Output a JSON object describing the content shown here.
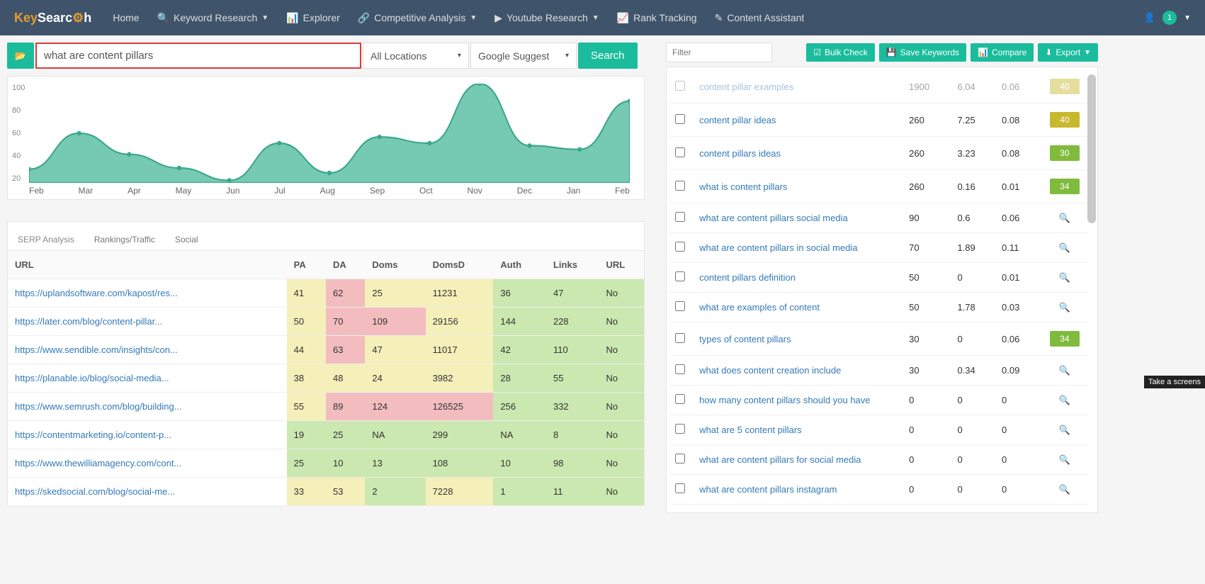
{
  "nav": {
    "home": "Home",
    "keyword_research": "Keyword Research",
    "explorer": "Explorer",
    "competitive": "Competitive Analysis",
    "youtube": "Youtube Research",
    "rank": "Rank Tracking",
    "content": "Content Assistant",
    "user_badge": "1"
  },
  "search": {
    "query": "what are content pillars",
    "location": "All Locations",
    "engine": "Google Suggest",
    "button": "Search"
  },
  "right_toolbar": {
    "filter_placeholder": "Filter",
    "bulk": "Bulk Check",
    "save": "Save Keywords",
    "compare": "Compare",
    "export": "Export"
  },
  "chart_data": {
    "type": "area",
    "categories": [
      "Feb",
      "Mar",
      "Apr",
      "May",
      "Jun",
      "Jul",
      "Aug",
      "Sep",
      "Oct",
      "Nov",
      "Dec",
      "Jan",
      "Feb"
    ],
    "values": [
      31,
      60,
      43,
      32,
      22,
      52,
      28,
      57,
      52,
      100,
      50,
      47,
      86
    ],
    "ylim": [
      20,
      100
    ],
    "yticks": [
      100,
      80,
      60,
      40,
      20
    ],
    "xlabel": "",
    "ylabel": "",
    "title": ""
  },
  "serp_tabs": {
    "serp": "SERP Analysis",
    "rank": "Rankings/Traffic",
    "social": "Social"
  },
  "serp_headers": {
    "url": "URL",
    "pa": "PA",
    "da": "DA",
    "doms": "Doms",
    "domsd": "DomsD",
    "auth": "Auth",
    "links": "Links",
    "url2": "URL"
  },
  "serp_rows": [
    {
      "url": "https://uplandsoftware.com/kapost/res...",
      "pa": "41",
      "pa_c": "y",
      "da": "62",
      "da_c": "p",
      "doms": "25",
      "doms_c": "y",
      "domsd": "11231",
      "domsd_c": "y",
      "auth": "36",
      "auth_c": "g",
      "links": "47",
      "links_c": "g",
      "u2": "No",
      "u2_c": "g"
    },
    {
      "url": "https://later.com/blog/content-pillar...",
      "pa": "50",
      "pa_c": "y",
      "da": "70",
      "da_c": "p",
      "doms": "109",
      "doms_c": "p",
      "domsd": "29156",
      "domsd_c": "y",
      "auth": "144",
      "auth_c": "g",
      "links": "228",
      "links_c": "g",
      "u2": "No",
      "u2_c": "g"
    },
    {
      "url": "https://www.sendible.com/insights/con...",
      "pa": "44",
      "pa_c": "y",
      "da": "63",
      "da_c": "p",
      "doms": "47",
      "doms_c": "y",
      "domsd": "11017",
      "domsd_c": "y",
      "auth": "42",
      "auth_c": "g",
      "links": "110",
      "links_c": "g",
      "u2": "No",
      "u2_c": "g"
    },
    {
      "url": "https://planable.io/blog/social-media...",
      "pa": "38",
      "pa_c": "y",
      "da": "48",
      "da_c": "y",
      "doms": "24",
      "doms_c": "y",
      "domsd": "3982",
      "domsd_c": "y",
      "auth": "28",
      "auth_c": "g",
      "links": "55",
      "links_c": "g",
      "u2": "No",
      "u2_c": "g"
    },
    {
      "url": "https://www.semrush.com/blog/building...",
      "pa": "55",
      "pa_c": "y",
      "da": "89",
      "da_c": "p",
      "doms": "124",
      "doms_c": "p",
      "domsd": "126525",
      "domsd_c": "p",
      "auth": "256",
      "auth_c": "g",
      "links": "332",
      "links_c": "g",
      "u2": "No",
      "u2_c": "g"
    },
    {
      "url": "https://contentmarketing.io/content-p...",
      "pa": "19",
      "pa_c": "g",
      "da": "25",
      "da_c": "g",
      "doms": "NA",
      "doms_c": "g",
      "domsd": "299",
      "domsd_c": "g",
      "auth": "NA",
      "auth_c": "g",
      "links": "8",
      "links_c": "g",
      "u2": "No",
      "u2_c": "g"
    },
    {
      "url": "https://www.thewilliamagency.com/cont...",
      "pa": "25",
      "pa_c": "g",
      "da": "10",
      "da_c": "g",
      "doms": "13",
      "doms_c": "g",
      "domsd": "108",
      "domsd_c": "g",
      "auth": "10",
      "auth_c": "g",
      "links": "98",
      "links_c": "g",
      "u2": "No",
      "u2_c": "g"
    },
    {
      "url": "https://skedsocial.com/blog/social-me...",
      "pa": "33",
      "pa_c": "y",
      "da": "53",
      "da_c": "y",
      "doms": "2",
      "doms_c": "g",
      "domsd": "7228",
      "domsd_c": "y",
      "auth": "1",
      "auth_c": "g",
      "links": "11",
      "links_c": "g",
      "u2": "No",
      "u2_c": "g"
    }
  ],
  "keywords": [
    {
      "kw": "content pillar examples",
      "vol": "1900",
      "c1": "6.04",
      "c2": "0.06",
      "diff": "40",
      "diffc": "40",
      "faded": true
    },
    {
      "kw": "content pillar ideas",
      "vol": "260",
      "c1": "7.25",
      "c2": "0.08",
      "diff": "40",
      "diffc": "40"
    },
    {
      "kw": "content pillars ideas",
      "vol": "260",
      "c1": "3.23",
      "c2": "0.08",
      "diff": "30",
      "diffc": "30"
    },
    {
      "kw": "what is content pillars",
      "vol": "260",
      "c1": "0.16",
      "c2": "0.01",
      "diff": "34",
      "diffc": "34"
    },
    {
      "kw": "what are content pillars social media",
      "vol": "90",
      "c1": "0.6",
      "c2": "0.06",
      "diff": "",
      "diffc": "mag"
    },
    {
      "kw": "what are content pillars in social media",
      "vol": "70",
      "c1": "1.89",
      "c2": "0.11",
      "diff": "",
      "diffc": "mag"
    },
    {
      "kw": "content pillars definition",
      "vol": "50",
      "c1": "0",
      "c2": "0.01",
      "diff": "",
      "diffc": "mag"
    },
    {
      "kw": "what are examples of content",
      "vol": "50",
      "c1": "1.78",
      "c2": "0.03",
      "diff": "",
      "diffc": "mag"
    },
    {
      "kw": "types of content pillars",
      "vol": "30",
      "c1": "0",
      "c2": "0.06",
      "diff": "34",
      "diffc": "34"
    },
    {
      "kw": "what does content creation include",
      "vol": "30",
      "c1": "0.34",
      "c2": "0.09",
      "diff": "",
      "diffc": "mag"
    },
    {
      "kw": "how many content pillars should you have",
      "vol": "0",
      "c1": "0",
      "c2": "0",
      "diff": "",
      "diffc": "mag"
    },
    {
      "kw": "what are 5 content pillars",
      "vol": "0",
      "c1": "0",
      "c2": "0",
      "diff": "",
      "diffc": "mag"
    },
    {
      "kw": "what are content pillars for social media",
      "vol": "0",
      "c1": "0",
      "c2": "0",
      "diff": "",
      "diffc": "mag"
    },
    {
      "kw": "what are content pillars instagram",
      "vol": "0",
      "c1": "0",
      "c2": "0",
      "diff": "",
      "diffc": "mag"
    }
  ],
  "tooltip": "Take a screens"
}
